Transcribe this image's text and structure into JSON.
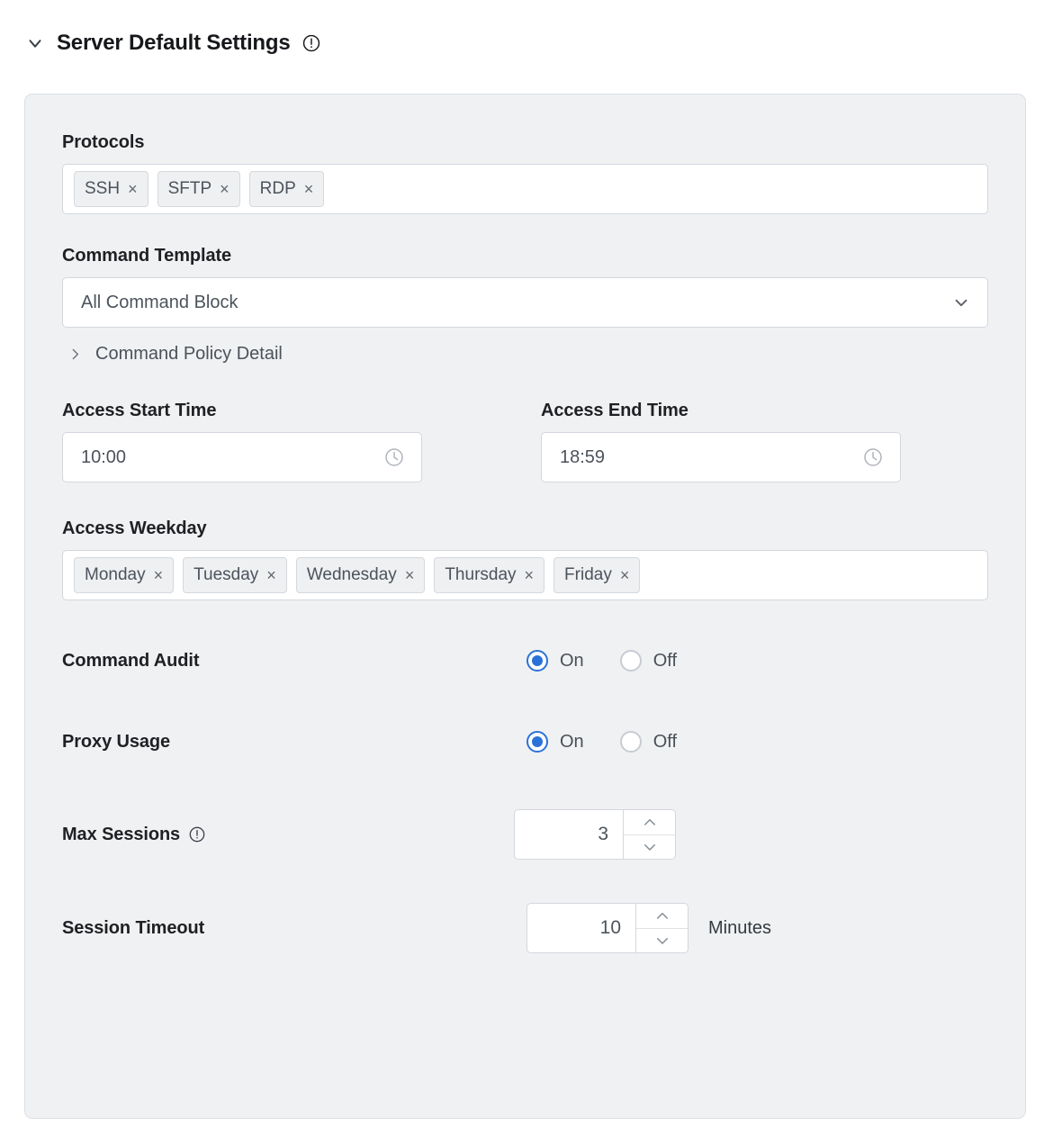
{
  "header": {
    "title": "Server Default Settings",
    "collapse_icon": "chevron-down-icon",
    "info_icon": "exclamation-circle-icon",
    "expanded": true
  },
  "form": {
    "protocols": {
      "label": "Protocols",
      "tags": [
        "SSH",
        "SFTP",
        "RDP"
      ],
      "remove_glyph": "×"
    },
    "command_template": {
      "label": "Command Template",
      "value": "All Command Block",
      "chevron_icon": "chevron-down-icon"
    },
    "command_policy_detail": {
      "label": "Command Policy Detail",
      "chevron_icon": "chevron-right-icon",
      "expanded": false
    },
    "access_start_time": {
      "label": "Access Start Time",
      "value": "10:00",
      "icon": "clock-icon"
    },
    "access_end_time": {
      "label": "Access End Time",
      "value": "18:59",
      "icon": "clock-icon"
    },
    "access_weekday": {
      "label": "Access Weekday",
      "tags": [
        "Monday",
        "Tuesday",
        "Wednesday",
        "Thursday",
        "Friday"
      ],
      "remove_glyph": "×"
    },
    "command_audit": {
      "label": "Command Audit",
      "options": [
        "On",
        "Off"
      ],
      "selected": "On"
    },
    "proxy_usage": {
      "label": "Proxy Usage",
      "options": [
        "On",
        "Off"
      ],
      "selected": "On"
    },
    "max_sessions": {
      "label": "Max Sessions",
      "info_icon": "exclamation-circle-icon",
      "value": "3"
    },
    "session_timeout": {
      "label": "Session Timeout",
      "value": "10",
      "unit": "Minutes"
    }
  },
  "colors": {
    "panel_bg": "#f0f1f3",
    "panel_border": "#dcdfe4",
    "field_bg": "#ffffff",
    "field_border": "#d3d7dd",
    "accent_blue": "#2b72d8",
    "text_primary": "#1f2023",
    "text_secondary": "#4c535c",
    "tag_bg": "#eef0f2"
  }
}
